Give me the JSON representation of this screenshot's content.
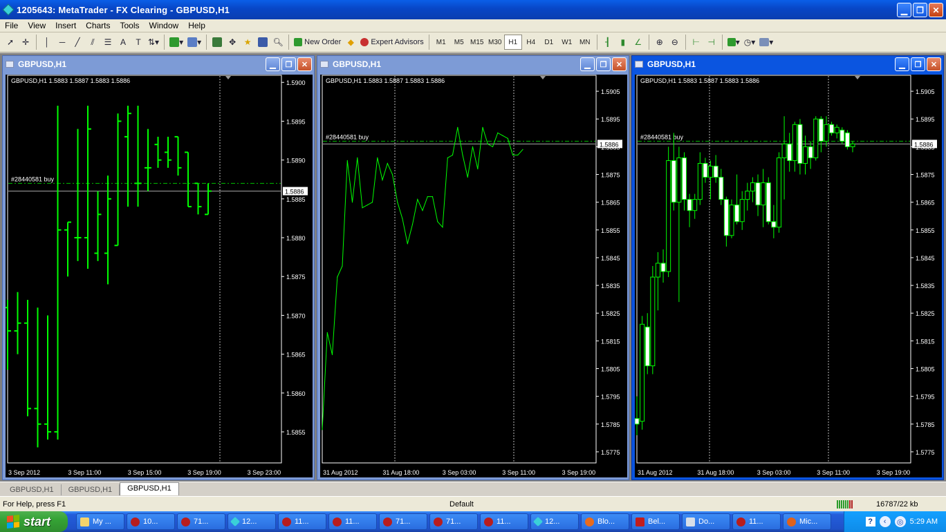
{
  "app": {
    "title": "1205643: MetaTrader - FX Clearing - GBPUSD,H1"
  },
  "menu": [
    "File",
    "View",
    "Insert",
    "Charts",
    "Tools",
    "Window",
    "Help"
  ],
  "toolbar": {
    "new_order": "New Order",
    "expert_advisors": "Expert Advisors",
    "timeframes": [
      "M1",
      "M5",
      "M15",
      "M30",
      "H1",
      "H4",
      "D1",
      "W1",
      "MN"
    ],
    "selected_timeframe": "H1"
  },
  "windows": [
    {
      "title": "GBPUSD,H1",
      "header": "GBPUSD,H1  1.5883 1.5887 1.5883 1.5886",
      "order_label": "#28440581 buy",
      "last_price": "1.5886",
      "price_axis": [
        "1.5900",
        "1.5895",
        "1.5890",
        "1.5885",
        "1.5880",
        "1.5875",
        "1.5870",
        "1.5865",
        "1.5860",
        "1.5855"
      ],
      "time_axis": [
        "3 Sep 2012",
        "3 Sep 11:00",
        "3 Sep 15:00",
        "3 Sep 19:00",
        "3 Sep 23:00"
      ]
    },
    {
      "title": "GBPUSD,H1",
      "header": "GBPUSD,H1  1.5883 1.5887 1.5883 1.5886",
      "order_label": "#28440581 buy",
      "last_price": "1.5886",
      "price_axis": [
        "1.5905",
        "1.5895",
        "1.5885",
        "1.5875",
        "1.5865",
        "1.5855",
        "1.5845",
        "1.5835",
        "1.5825",
        "1.5815",
        "1.5805",
        "1.5795",
        "1.5785",
        "1.5775"
      ],
      "time_axis": [
        "31 Aug 2012",
        "31 Aug 18:00",
        "3 Sep 03:00",
        "3 Sep 11:00",
        "3 Sep 19:00"
      ]
    },
    {
      "title": "GBPUSD,H1",
      "header": "GBPUSD,H1  1.5883 1.5887 1.5883 1.5886",
      "order_label": "#28440581 buy",
      "last_price": "1.5886",
      "price_axis": [
        "1.5905",
        "1.5895",
        "1.5885",
        "1.5875",
        "1.5865",
        "1.5855",
        "1.5845",
        "1.5835",
        "1.5825",
        "1.5815",
        "1.5805",
        "1.5795",
        "1.5785",
        "1.5775"
      ],
      "time_axis": [
        "31 Aug 2012",
        "31 Aug 18:00",
        "3 Sep 03:00",
        "3 Sep 11:00",
        "3 Sep 19:00"
      ]
    }
  ],
  "chart_data": [
    {
      "type": "bar",
      "title": "GBPUSD,H1",
      "ylim": [
        1.5851,
        1.5901
      ],
      "bar_style": "ohlc",
      "order_line": 1.5887,
      "bid_line": 1.5886,
      "series": [
        {
          "o": 1.5871,
          "h": 1.5872,
          "l": 1.5863,
          "c": 1.5868
        },
        {
          "o": 1.5868,
          "h": 1.5873,
          "l": 1.5865,
          "c": 1.5869
        },
        {
          "o": 1.5869,
          "h": 1.5872,
          "l": 1.5857,
          "c": 1.5858
        },
        {
          "o": 1.5858,
          "h": 1.5871,
          "l": 1.5853,
          "c": 1.5856
        },
        {
          "o": 1.5856,
          "h": 1.587,
          "l": 1.5854,
          "c": 1.5855
        },
        {
          "o": 1.5855,
          "h": 1.5897,
          "l": 1.5854,
          "c": 1.5881
        },
        {
          "o": 1.5881,
          "h": 1.5882,
          "l": 1.5875,
          "c": 1.5882
        },
        {
          "o": 1.588,
          "h": 1.5894,
          "l": 1.5877,
          "c": 1.588
        },
        {
          "o": 1.588,
          "h": 1.5897,
          "l": 1.5876,
          "c": 1.5894
        },
        {
          "o": 1.5878,
          "h": 1.5886,
          "l": 1.5877,
          "c": 1.5883
        },
        {
          "o": 1.5878,
          "h": 1.5888,
          "l": 1.5874,
          "c": 1.5885
        },
        {
          "o": 1.5879,
          "h": 1.5896,
          "l": 1.5879,
          "c": 1.5895
        },
        {
          "o": 1.5893,
          "h": 1.5897,
          "l": 1.5884,
          "c": 1.5896
        },
        {
          "o": 1.5887,
          "h": 1.5897,
          "l": 1.5884,
          "c": 1.5887
        },
        {
          "o": 1.5889,
          "h": 1.5894,
          "l": 1.5886,
          "c": 1.5889
        },
        {
          "o": 1.5892,
          "h": 1.5893,
          "l": 1.5889,
          "c": 1.589
        },
        {
          "o": 1.5891,
          "h": 1.5893,
          "l": 1.5889,
          "c": 1.589
        },
        {
          "o": 1.5893,
          "h": 1.5893,
          "l": 1.5888,
          "c": 1.5889
        },
        {
          "o": 1.5891,
          "h": 1.5891,
          "l": 1.5884,
          "c": 1.5884
        },
        {
          "o": 1.5887,
          "h": 1.5887,
          "l": 1.5883,
          "c": 1.5884
        },
        {
          "o": 1.5883,
          "h": 1.5887,
          "l": 1.5883,
          "c": 1.5886
        }
      ]
    },
    {
      "type": "line",
      "title": "GBPUSD,H1",
      "ylim": [
        1.5771,
        1.5911
      ],
      "order_line": 1.5887,
      "bid_line": 1.5886,
      "values": [
        1.5783,
        1.5818,
        1.581,
        1.5838,
        1.5842,
        1.588,
        1.5865,
        1.5881,
        1.5863,
        1.5864,
        1.5865,
        1.5881,
        1.5873,
        1.5879,
        1.5875,
        1.5865,
        1.5859,
        1.585,
        1.5857,
        1.5866,
        1.5862,
        1.5867,
        1.5867,
        1.5858,
        1.5856,
        1.5881,
        1.5882,
        1.5892,
        1.5882,
        1.5874,
        1.5885,
        1.5877,
        1.5892,
        1.5886,
        1.5885,
        1.589,
        1.5889,
        1.5888,
        1.5882,
        1.5882,
        1.5884
      ]
    },
    {
      "type": "bar",
      "title": "GBPUSD,H1",
      "ylim": [
        1.5771,
        1.5911
      ],
      "bar_style": "candle",
      "order_line": 1.5887,
      "bid_line": 1.5886,
      "series": [
        {
          "o": 1.5787,
          "h": 1.5795,
          "l": 1.5781,
          "c": 1.5785
        },
        {
          "o": 1.5786,
          "h": 1.5824,
          "l": 1.5783,
          "c": 1.5821
        },
        {
          "o": 1.582,
          "h": 1.5825,
          "l": 1.5803,
          "c": 1.5806
        },
        {
          "o": 1.5806,
          "h": 1.5842,
          "l": 1.5803,
          "c": 1.5838
        },
        {
          "o": 1.5838,
          "h": 1.5847,
          "l": 1.5826,
          "c": 1.5843
        },
        {
          "o": 1.5843,
          "h": 1.5848,
          "l": 1.5836,
          "c": 1.584
        },
        {
          "o": 1.584,
          "h": 1.5885,
          "l": 1.5838,
          "c": 1.588
        },
        {
          "o": 1.588,
          "h": 1.589,
          "l": 1.5862,
          "c": 1.5865
        },
        {
          "o": 1.5865,
          "h": 1.5885,
          "l": 1.5829,
          "c": 1.5881
        },
        {
          "o": 1.5881,
          "h": 1.5883,
          "l": 1.5862,
          "c": 1.5866
        },
        {
          "o": 1.5866,
          "h": 1.5868,
          "l": 1.5856,
          "c": 1.5862
        },
        {
          "o": 1.5862,
          "h": 1.5868,
          "l": 1.5859,
          "c": 1.5866
        },
        {
          "o": 1.5866,
          "h": 1.5883,
          "l": 1.5864,
          "c": 1.5879
        },
        {
          "o": 1.5879,
          "h": 1.5881,
          "l": 1.5872,
          "c": 1.5874
        },
        {
          "o": 1.5874,
          "h": 1.588,
          "l": 1.5866,
          "c": 1.5878
        },
        {
          "o": 1.5878,
          "h": 1.5882,
          "l": 1.5872,
          "c": 1.5874
        },
        {
          "o": 1.5874,
          "h": 1.5877,
          "l": 1.5864,
          "c": 1.5866
        },
        {
          "o": 1.5866,
          "h": 1.5867,
          "l": 1.5849,
          "c": 1.5853
        },
        {
          "o": 1.5853,
          "h": 1.5866,
          "l": 1.5852,
          "c": 1.5864
        },
        {
          "o": 1.5864,
          "h": 1.5875,
          "l": 1.5857,
          "c": 1.5858
        },
        {
          "o": 1.5858,
          "h": 1.5869,
          "l": 1.5855,
          "c": 1.5866
        },
        {
          "o": 1.5866,
          "h": 1.5872,
          "l": 1.5862,
          "c": 1.5869
        },
        {
          "o": 1.5869,
          "h": 1.5874,
          "l": 1.5865,
          "c": 1.5872
        },
        {
          "o": 1.5872,
          "h": 1.5875,
          "l": 1.586,
          "c": 1.5864
        },
        {
          "o": 1.5864,
          "h": 1.5877,
          "l": 1.5856,
          "c": 1.5872
        },
        {
          "o": 1.5872,
          "h": 1.5874,
          "l": 1.5857,
          "c": 1.5858
        },
        {
          "o": 1.5858,
          "h": 1.5864,
          "l": 1.5852,
          "c": 1.5856
        },
        {
          "o": 1.5856,
          "h": 1.5883,
          "l": 1.5854,
          "c": 1.5881
        },
        {
          "o": 1.5881,
          "h": 1.5896,
          "l": 1.5866,
          "c": 1.5886
        },
        {
          "o": 1.5886,
          "h": 1.589,
          "l": 1.5876,
          "c": 1.588
        },
        {
          "o": 1.588,
          "h": 1.5894,
          "l": 1.5876,
          "c": 1.5893
        },
        {
          "o": 1.5893,
          "h": 1.5895,
          "l": 1.5875,
          "c": 1.5879
        },
        {
          "o": 1.5879,
          "h": 1.5889,
          "l": 1.5875,
          "c": 1.5885
        },
        {
          "o": 1.5885,
          "h": 1.5887,
          "l": 1.5877,
          "c": 1.5881
        },
        {
          "o": 1.5881,
          "h": 1.5896,
          "l": 1.588,
          "c": 1.5895
        },
        {
          "o": 1.5895,
          "h": 1.5896,
          "l": 1.5883,
          "c": 1.5887
        },
        {
          "o": 1.5887,
          "h": 1.5896,
          "l": 1.5885,
          "c": 1.5893
        },
        {
          "o": 1.5893,
          "h": 1.5894,
          "l": 1.5889,
          "c": 1.589
        },
        {
          "o": 1.589,
          "h": 1.5893,
          "l": 1.5888,
          "c": 1.5892
        },
        {
          "o": 1.5891,
          "h": 1.5892,
          "l": 1.5886,
          "c": 1.5887
        },
        {
          "o": 1.589,
          "h": 1.5891,
          "l": 1.5884,
          "c": 1.5885
        },
        {
          "o": 1.5885,
          "h": 1.5887,
          "l": 1.5883,
          "c": 1.5886
        }
      ]
    }
  ],
  "tabs": [
    "GBPUSD,H1",
    "GBPUSD,H1",
    "GBPUSD,H1"
  ],
  "active_tab": 2,
  "status": {
    "help": "For Help, press F1",
    "profile": "Default",
    "traffic": "16787/22 kb"
  },
  "taskbar": {
    "start": "start",
    "tasks": [
      {
        "label": "My ...",
        "icon": "folder-icon"
      },
      {
        "label": "10...",
        "icon": "ie-icon"
      },
      {
        "label": "71...",
        "icon": "ie-icon"
      },
      {
        "label": "12...",
        "icon": "metatrader-icon"
      },
      {
        "label": "11...",
        "icon": "ie-icon"
      },
      {
        "label": "11...",
        "icon": "ie-icon"
      },
      {
        "label": "71...",
        "icon": "ie-icon"
      },
      {
        "label": "71...",
        "icon": "ie-icon"
      },
      {
        "label": "11...",
        "icon": "ie-icon"
      },
      {
        "label": "12...",
        "icon": "metatrader-icon"
      },
      {
        "label": "Blo...",
        "icon": "firefox-icon"
      },
      {
        "label": "Bel...",
        "icon": "pdf-icon"
      },
      {
        "label": "Do...",
        "icon": "document-icon"
      },
      {
        "label": "11...",
        "icon": "ie-icon"
      },
      {
        "label": "Mic...",
        "icon": "powerpoint-icon"
      }
    ],
    "clock": "5:29 AM"
  },
  "colors": {
    "chart_bg": "#000000",
    "series": "#00ff00",
    "grid_text": "#ffffff",
    "order_line": "#00c000"
  }
}
